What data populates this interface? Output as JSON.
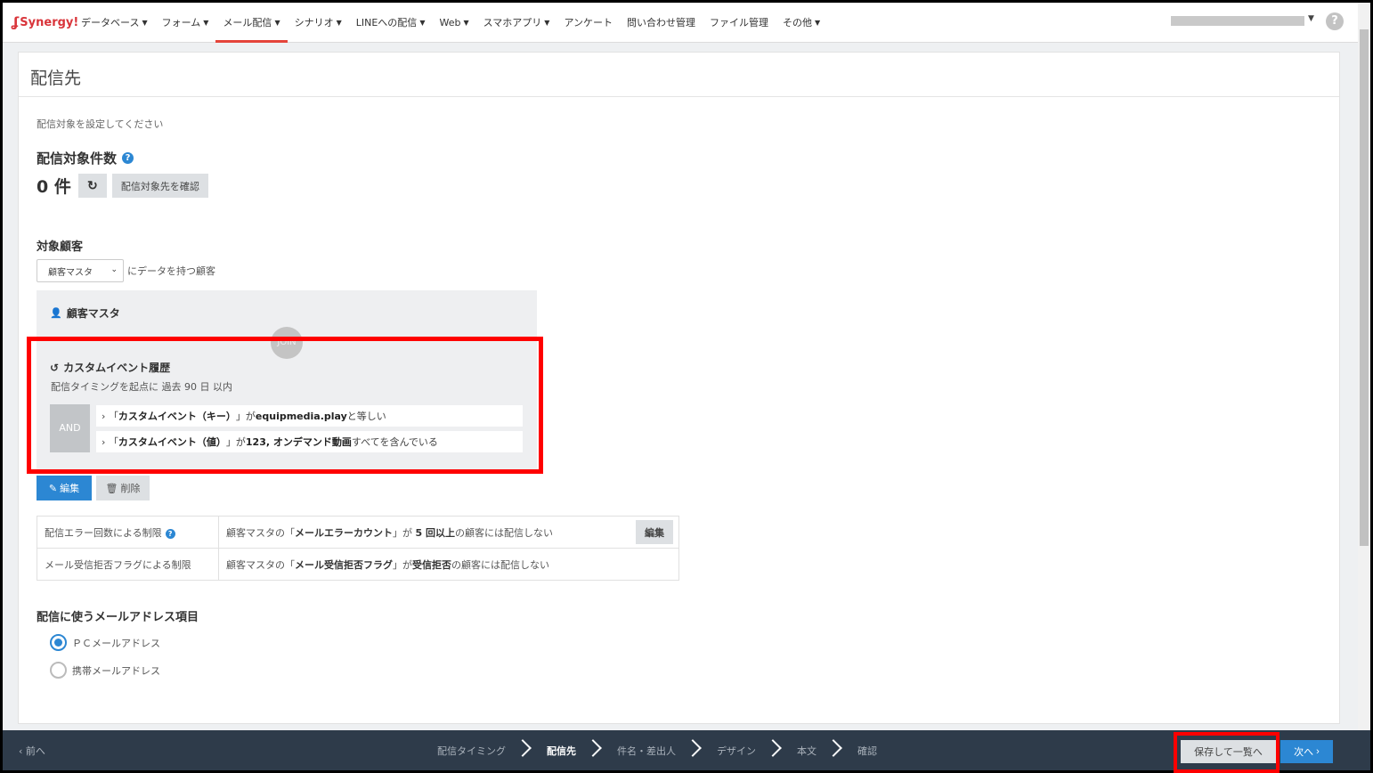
{
  "brand": {
    "logo_text": "Synergy!",
    "accent": "#e4443a",
    "primary": "#2c87d3"
  },
  "nav": {
    "items": [
      {
        "label": "データベース",
        "dropdown": true
      },
      {
        "label": "フォーム",
        "dropdown": true
      },
      {
        "label": "メール配信",
        "dropdown": true,
        "active": true
      },
      {
        "label": "シナリオ",
        "dropdown": true
      },
      {
        "label": "LINEへの配信",
        "dropdown": true
      },
      {
        "label": "Web",
        "dropdown": true
      },
      {
        "label": "スマホアプリ",
        "dropdown": true
      },
      {
        "label": "アンケート",
        "dropdown": false
      },
      {
        "label": "問い合わせ管理",
        "dropdown": false
      },
      {
        "label": "ファイル管理",
        "dropdown": false
      },
      {
        "label": "その他",
        "dropdown": true
      }
    ],
    "help_icon": "question-circle-icon"
  },
  "page": {
    "title": "配信先",
    "instruction": "配信対象を設定してください"
  },
  "count": {
    "title": "配信対象件数",
    "value": "0 件",
    "refresh_icon": "refresh-icon",
    "confirm_label": "配信対象先を確認"
  },
  "target": {
    "title": "対象顧客",
    "select_value": "顧客マスタ",
    "suffix": "にデータを持つ顧客"
  },
  "condition": {
    "master_label": "顧客マスタ",
    "join_label": "JOIN",
    "event_title": "カスタムイベント履歴",
    "event_sub": "配信タイミングを起点に 過去 90 日 以内",
    "operator": "AND",
    "rows": [
      {
        "prefix": "「",
        "field": "カスタムイベント（キー）",
        "mid": "」が ",
        "value": "equipmedia.play",
        "op": " と等しい"
      },
      {
        "prefix": "「",
        "field": "カスタムイベント（値）",
        "mid": "」が ",
        "value": "123, オンデマンド動画",
        "op": " すべてを含んでいる"
      }
    ],
    "edit_label": "編集",
    "delete_label": "削除"
  },
  "limits": [
    {
      "label": "配信エラー回数による制限",
      "t1": "顧客マスタの「",
      "b1": "メールエラーカウント",
      "t2": "」が ",
      "b2": "5 回以上",
      "t3": "の顧客には配信しない",
      "button": "編集"
    },
    {
      "label": "メール受信拒否フラグによる制限",
      "t1": "顧客マスタの「",
      "b1": "メール受信拒否フラグ",
      "t2": "」が",
      "b2": "受信拒否",
      "t3": "の顧客には配信しない"
    }
  ],
  "address": {
    "title": "配信に使うメールアドレス項目",
    "options": [
      {
        "label": "ＰＣメールアドレス",
        "selected": true
      },
      {
        "label": "携帯メールアドレス",
        "selected": false
      }
    ]
  },
  "footer": {
    "prev_label": "前へ",
    "steps": [
      "配信タイミング",
      "配信先",
      "件名・差出人",
      "デザイン",
      "本文",
      "確認"
    ],
    "current_step": "配信先",
    "save_label": "保存して一覧へ",
    "next_label": "次へ"
  }
}
